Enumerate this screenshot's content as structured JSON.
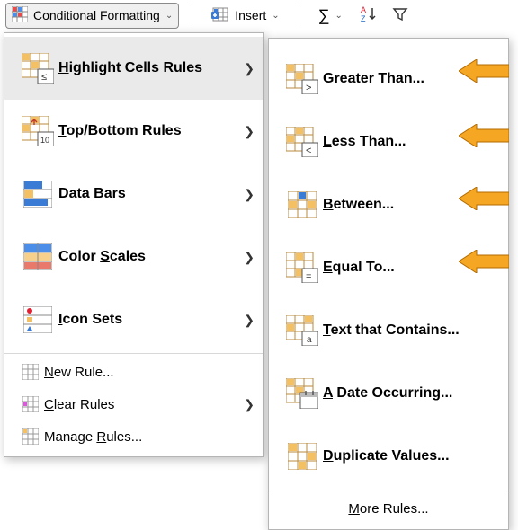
{
  "toolbar": {
    "cond_label": "Conditional Formatting",
    "insert_label": "Insert"
  },
  "menu1": {
    "highlight": "Highlight Cells Rules",
    "topbottom": "Top/Bottom Rules",
    "databars": "Data Bars",
    "colorscales": "Color Scales",
    "iconsets": "Icon Sets",
    "newrule": "New Rule...",
    "clearrules": "Clear Rules",
    "managerules": "Manage Rules..."
  },
  "menu2": {
    "greater": "Greater Than...",
    "less": "Less Than...",
    "between": "Between...",
    "equal": "Equal To...",
    "textcontains": "Text that Contains...",
    "dateoccurring": "A Date Occurring...",
    "duplicate": "Duplicate Values...",
    "more": "More Rules..."
  },
  "accent": {
    "arrow_fill": "#f5a623",
    "arrow_stroke": "#b36b00"
  }
}
